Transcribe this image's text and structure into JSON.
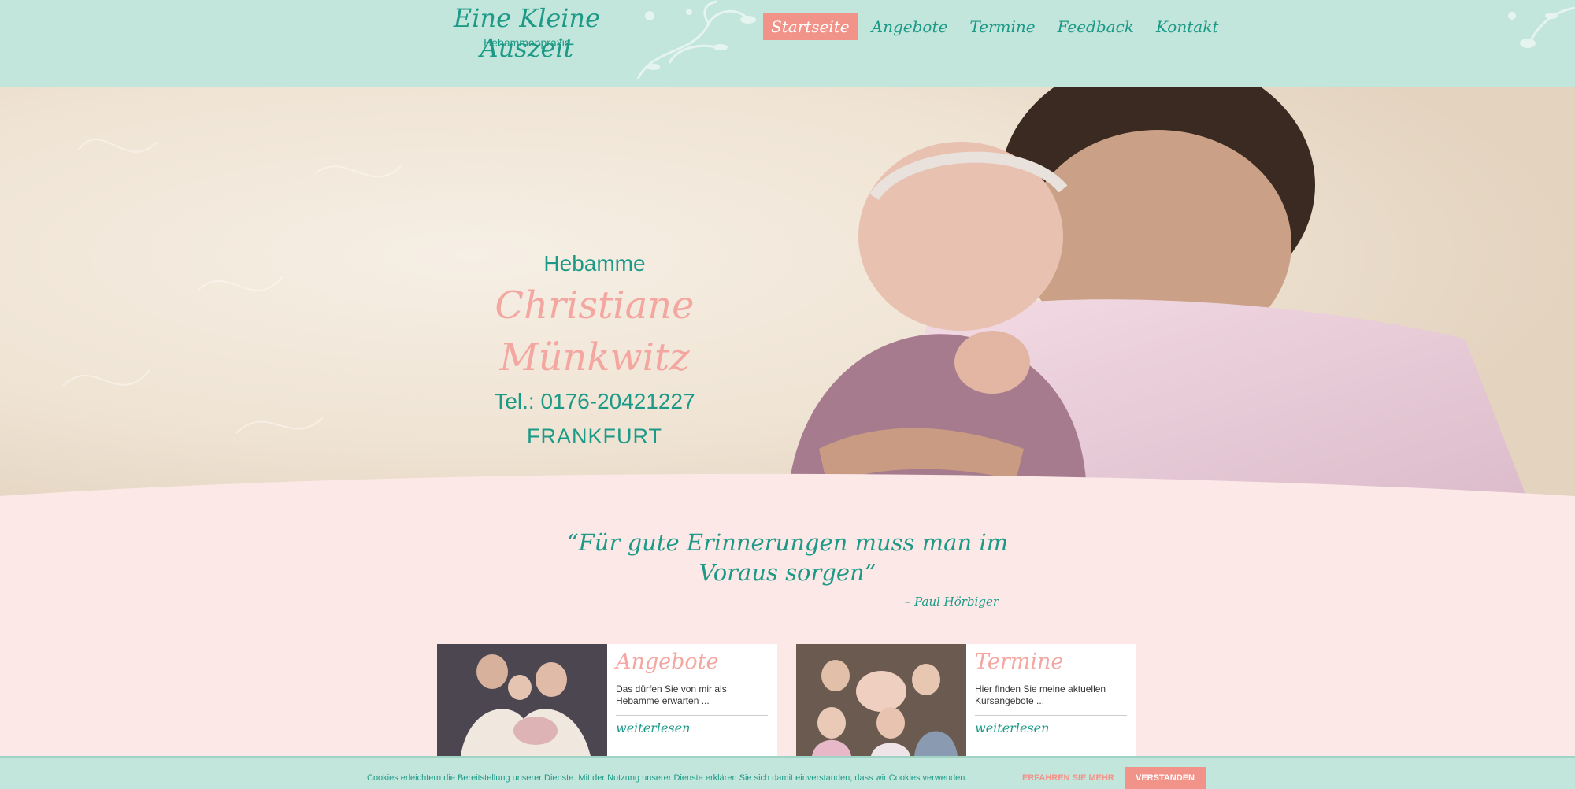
{
  "header": {
    "logo_title": "Eine Kleine Auszeit",
    "logo_subtitle": "Hebammenpraxis",
    "nav": [
      {
        "label": "Startseite",
        "active": true
      },
      {
        "label": "Angebote",
        "active": false
      },
      {
        "label": "Termine",
        "active": false
      },
      {
        "label": "Feedback",
        "active": false
      },
      {
        "label": "Kontakt",
        "active": false
      }
    ]
  },
  "hero": {
    "line1": "Hebamme",
    "name": "Christiane Münkwitz",
    "tel": "Tel.: 0176-20421227",
    "city": "FRANKFURT"
  },
  "quote": {
    "text": "“Für gute Erinnerungen muss man im Voraus sorgen”",
    "author": "– Paul Hörbiger"
  },
  "cards": [
    {
      "title": "Angebote",
      "text": "Das dürfen Sie von mir als Hebamme erwarten ...",
      "more": "weiterlesen"
    },
    {
      "title": "Termine",
      "text": "Hier finden Sie meine aktuellen Kursangebote ...",
      "more": "weiterlesen"
    }
  ],
  "cookie": {
    "text": "Cookies erleichtern die Bereitstellung unserer Dienste. Mit der Nutzung unserer Dienste erklären Sie sich damit einverstanden, dass wir Cookies verwenden.",
    "more": "ERFAHREN SIE MEHR",
    "accept": "VERSTANDEN"
  },
  "colors": {
    "mint": "#c2e5dc",
    "teal": "#1d9a87",
    "pink": "#f4a6a0",
    "coral": "#f2938a",
    "blush_bg": "#fde8e8"
  }
}
